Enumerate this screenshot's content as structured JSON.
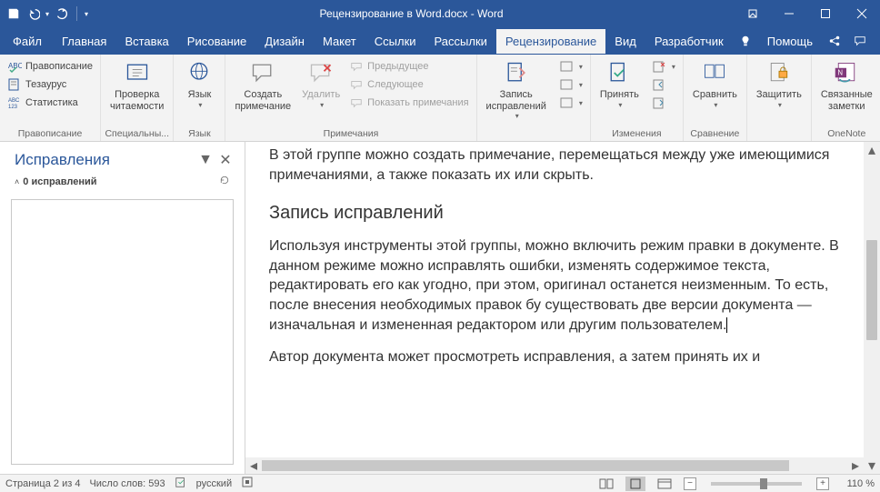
{
  "titlebar": {
    "doc_title": "Рецензирование в Word.docx  -  Word"
  },
  "tabs": {
    "file": "Файл",
    "home": "Главная",
    "insert": "Вставка",
    "draw": "Рисование",
    "design": "Дизайн",
    "layout": "Макет",
    "references": "Ссылки",
    "mailings": "Рассылки",
    "review": "Рецензирование",
    "view": "Вид",
    "developer": "Разработчик",
    "help": "Помощь"
  },
  "ribbon": {
    "proofing": {
      "label": "Правописание",
      "spelling": "Правописание",
      "thesaurus": "Тезаурус",
      "statistics": "Статистика"
    },
    "readability": {
      "label": "Специальны...",
      "btn": "Проверка\nчитаемости"
    },
    "language": {
      "label": "Язык",
      "btn": "Язык"
    },
    "comments": {
      "label": "Примечания",
      "create": "Создать\nпримечание",
      "delete": "Удалить",
      "prev": "Предыдущее",
      "next": "Следующее",
      "show": "Показать примечания"
    },
    "tracking": {
      "label": "",
      "btn": "Запись\nисправлений"
    },
    "changes": {
      "label": "Изменения",
      "accept": "Принять"
    },
    "compare": {
      "label": "Сравнение",
      "btn": "Сравнить"
    },
    "protect": {
      "label": "",
      "btn": "Защитить"
    },
    "onenote": {
      "label": "OneNote",
      "btn": "Связанные\nзаметки"
    }
  },
  "pane": {
    "title": "Исправления",
    "subtitle": "0 исправлений"
  },
  "document": {
    "p1": "В этой группе можно создать примечание, перемещаться между уже имеющимися примечаниями, а также показать их или скрыть.",
    "h1": "Запись исправлений",
    "p2": "Используя инструменты этой группы, можно включить режим правки в документе. В данном режиме можно исправлять ошибки, изменять содержимое текста, редактировать его как угодно, при этом, оригинал останется неизменным. То есть, после внесения необходимых правок бу существовать две версии документа — изначальная и измененная редактором или другим пользователем.",
    "p3": "Автор документа может просмотреть исправления, а затем принять их и"
  },
  "status": {
    "page": "Страница 2 из 4",
    "words": "Число слов: 593",
    "lang": "русский",
    "zoom": "110 %"
  }
}
